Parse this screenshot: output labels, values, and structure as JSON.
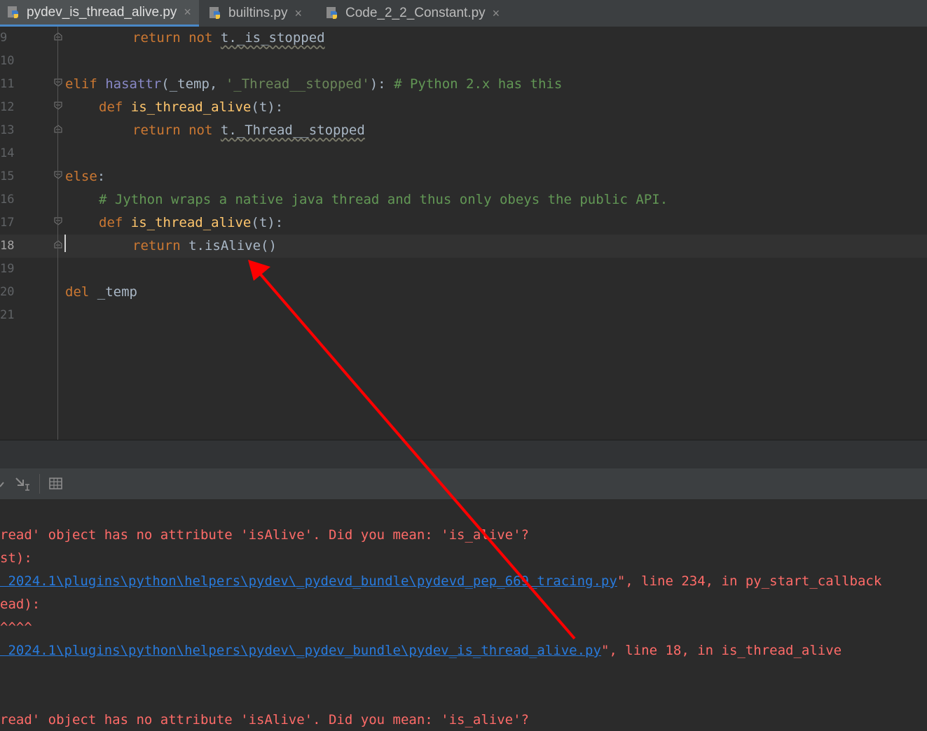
{
  "tabs": [
    {
      "label": "pydev_is_thread_alive.py",
      "active": true
    },
    {
      "label": "builtins.py",
      "active": false
    },
    {
      "label": "Code_2_2_Constant.py",
      "active": false
    }
  ],
  "close_glyph": "×",
  "editor": {
    "current_line": "18",
    "lines": [
      {
        "num": "9"
      },
      {
        "num": "10"
      },
      {
        "num": "11"
      },
      {
        "num": "12"
      },
      {
        "num": "13"
      },
      {
        "num": "14"
      },
      {
        "num": "15"
      },
      {
        "num": "16"
      },
      {
        "num": "17"
      },
      {
        "num": "18"
      },
      {
        "num": "19"
      },
      {
        "num": "20"
      },
      {
        "num": "21"
      }
    ],
    "tokens": {
      "l9_kw1": "return",
      "l9_kw2": "not",
      "l9_expr": "t._is_stopped",
      "l11_kw": "elif",
      "l11_bi": "hasattr",
      "l11_open": "(_temp, ",
      "l11_str": "'_Thread__stopped'",
      "l11_close": "):",
      "l11_cm": "# Python 2.x has this",
      "l12_kw": "def",
      "l12_fn": "is_thread_alive",
      "l12_args": "(t):",
      "l13_kw1": "return",
      "l13_kw2": "not",
      "l13_expr": "t._Thread__stopped",
      "l15_kw": "else",
      "l15_colon": ":",
      "l16_cm": "# Jython wraps a native java thread and thus only obeys the public API.",
      "l17_kw": "def",
      "l17_fn": "is_thread_alive",
      "l17_args": "(t):",
      "l18_kw": "return",
      "l18_expr": "t.isAlive()",
      "l20_kw": "del",
      "l20_var": "_temp"
    }
  },
  "console": {
    "line1": "read' object has no attribute 'isAlive'. Did you mean: 'is_alive'?",
    "line2": "st):",
    "line3_link": " 2024.1\\plugins\\python\\helpers\\pydev\\_pydevd_bundle\\pydevd_pep_669_tracing.py",
    "line3_rest": "\", line 234, in py_start_callback",
    "line4": "ead):",
    "line5": "^^^^",
    "line6_link": " 2024.1\\plugins\\python\\helpers\\pydev\\_pydev_bundle\\pydev_is_thread_alive.py",
    "line6_rest": "\", line 18, in is_thread_alive",
    "line7": "read' object has no attribute 'isAlive'. Did you mean: 'is_alive'?"
  },
  "colors": {
    "keyword": "#cc7832",
    "function": "#ffc66d",
    "comment": "#629755",
    "error": "#ff6b68",
    "link": "#287bde",
    "annotation_arrow": "#ff0000"
  }
}
